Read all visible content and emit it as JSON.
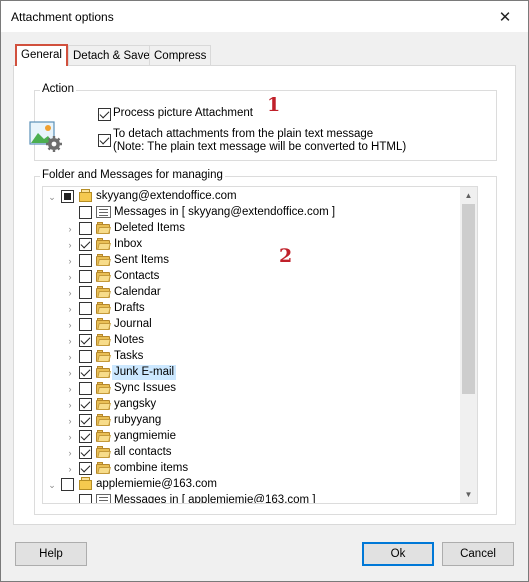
{
  "window": {
    "title": "Attachment options",
    "close_glyph": "✕"
  },
  "tabs": [
    {
      "label": "General",
      "active": true
    },
    {
      "label": "Detach & Save",
      "active": false
    },
    {
      "label": "Compress",
      "active": false
    }
  ],
  "action": {
    "group_label": "Action",
    "icon": "picture-settings-icon",
    "process_picture": {
      "label": "Process picture Attachment",
      "checked": true
    },
    "detach_plain": {
      "label": "To detach attachments from the plain text message",
      "note": "(Note: The plain text message will be converted to HTML)",
      "checked": true
    },
    "badge": "1"
  },
  "folders": {
    "group_label": "Folder and Messages for managing",
    "badge": "2",
    "rows": [
      {
        "label": "skyyang@extendoffice.com",
        "kind": "account",
        "check": "partial",
        "expander": "expanded",
        "indent": 0
      },
      {
        "label": "Messages in [ skyyang@extendoffice.com ]",
        "kind": "messages",
        "check": "unchecked",
        "expander": "none",
        "indent": 1
      },
      {
        "label": "Deleted Items",
        "kind": "folder",
        "check": "unchecked",
        "expander": "collapsed",
        "indent": 1
      },
      {
        "label": "Inbox",
        "kind": "folder",
        "check": "checked",
        "expander": "collapsed",
        "indent": 1
      },
      {
        "label": "Sent Items",
        "kind": "folder",
        "check": "unchecked",
        "expander": "collapsed",
        "indent": 1
      },
      {
        "label": "Contacts",
        "kind": "folder",
        "check": "unchecked",
        "expander": "collapsed",
        "indent": 1
      },
      {
        "label": "Calendar",
        "kind": "folder",
        "check": "unchecked",
        "expander": "collapsed",
        "indent": 1
      },
      {
        "label": "Drafts",
        "kind": "folder",
        "check": "unchecked",
        "expander": "collapsed",
        "indent": 1
      },
      {
        "label": "Journal",
        "kind": "folder",
        "check": "unchecked",
        "expander": "collapsed",
        "indent": 1
      },
      {
        "label": "Notes",
        "kind": "folder",
        "check": "checked",
        "expander": "collapsed",
        "indent": 1
      },
      {
        "label": "Tasks",
        "kind": "folder",
        "check": "unchecked",
        "expander": "collapsed",
        "indent": 1
      },
      {
        "label": "Junk E-mail",
        "kind": "folder",
        "check": "checked",
        "expander": "collapsed",
        "indent": 1,
        "selected": true
      },
      {
        "label": "Sync Issues",
        "kind": "folder",
        "check": "unchecked",
        "expander": "collapsed",
        "indent": 1
      },
      {
        "label": "yangsky",
        "kind": "folder",
        "check": "checked",
        "expander": "collapsed",
        "indent": 1
      },
      {
        "label": "rubyyang",
        "kind": "folder",
        "check": "checked",
        "expander": "collapsed",
        "indent": 1
      },
      {
        "label": "yangmiemie",
        "kind": "folder",
        "check": "checked",
        "expander": "collapsed",
        "indent": 1
      },
      {
        "label": "all contacts",
        "kind": "folder",
        "check": "checked",
        "expander": "collapsed",
        "indent": 1
      },
      {
        "label": "combine items",
        "kind": "folder",
        "check": "checked",
        "expander": "collapsed",
        "indent": 1
      },
      {
        "label": "applemiemie@163.com",
        "kind": "account",
        "check": "unchecked",
        "expander": "expanded",
        "indent": 0
      },
      {
        "label": "Messages in [ applemiemie@163.com ]",
        "kind": "messages",
        "check": "unchecked",
        "expander": "none",
        "indent": 1
      }
    ]
  },
  "buttons": {
    "help": "Help",
    "ok": "Ok",
    "cancel": "Cancel"
  },
  "colors": {
    "badge": "#c0202a",
    "tab_highlight": "#d1503d",
    "selection": "#cce8ff",
    "default_button": "#0078d7"
  }
}
